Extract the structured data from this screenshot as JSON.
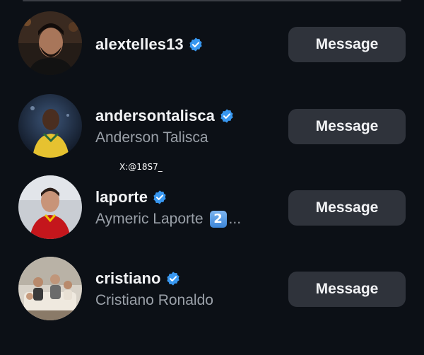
{
  "accent": "#3897f0",
  "button_bg": "#2f333b",
  "watermark": "X:@18S7_",
  "users": [
    {
      "username": "alextelles13",
      "full_name": "",
      "verified": true,
      "verified_icon": "verified-badge-icon",
      "button_label": "Message"
    },
    {
      "username": "andersontalisca",
      "full_name": "Anderson Talisca",
      "verified": true,
      "verified_icon": "verified-badge-icon",
      "button_label": "Message"
    },
    {
      "username": "laporte",
      "full_name": "Aymeric Laporte",
      "full_name_emoji": "2",
      "full_name_suffix": "...",
      "verified": true,
      "verified_icon": "verified-badge-icon",
      "button_label": "Message"
    },
    {
      "username": "cristiano",
      "full_name": "Cristiano Ronaldo",
      "verified": true,
      "verified_icon": "verified-badge-icon",
      "button_label": "Message"
    }
  ]
}
